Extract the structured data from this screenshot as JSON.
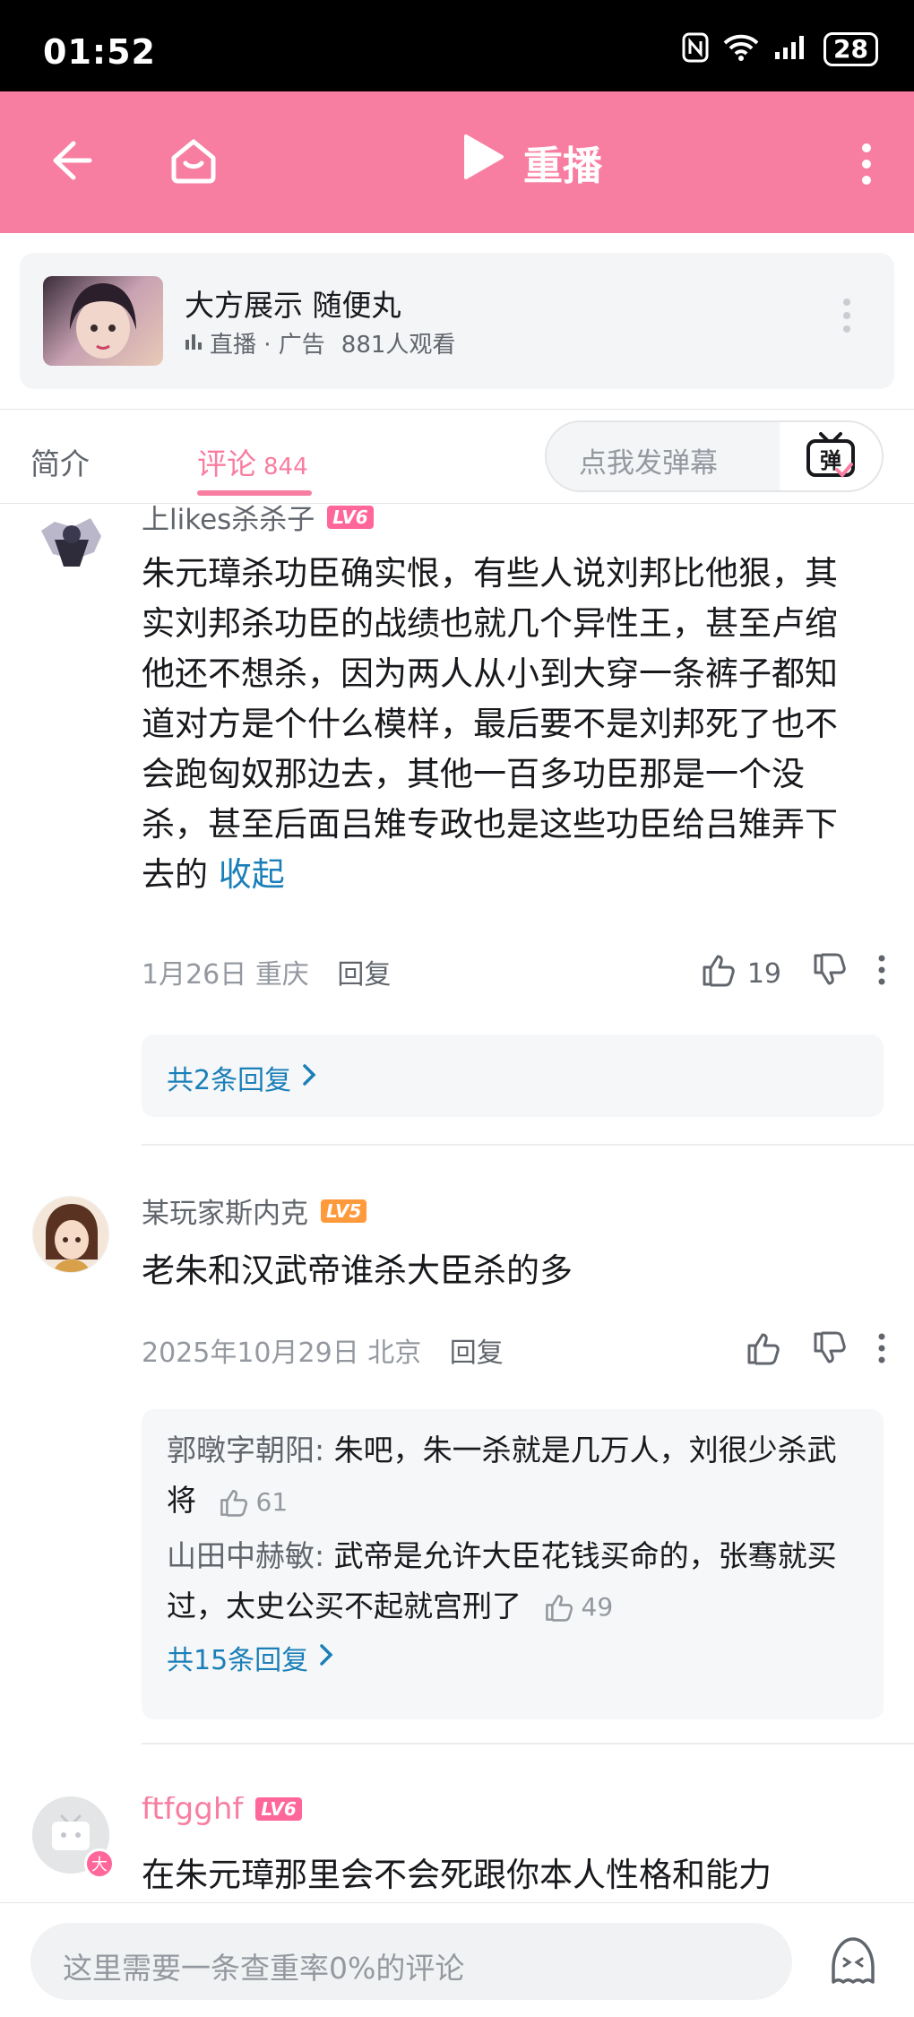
{
  "status": {
    "time": "01:52",
    "battery": "28"
  },
  "header": {
    "replay_label": "重播"
  },
  "live": {
    "title": "大方展示 随便丸",
    "tag": "直播 · 广告",
    "viewers": "881人观看"
  },
  "tabs": {
    "intro": "简介",
    "comments": "评论",
    "comment_count": "844"
  },
  "danmaku": {
    "placeholder": "点我发弹幕",
    "button": "弹"
  },
  "comments": [
    {
      "user": "上likes杀杀子",
      "level": "LV6",
      "text": "朱元璋杀功臣确实恨，有些人说刘邦比他狠，其实刘邦杀功臣的战绩也就几个异性王，甚至卢绾他还不想杀，因为两人从小到大穿一条裤子都知道对方是个什么模样，最后要不是刘邦死了也不会跑匈奴那边去，其他一百多功臣那是一个没杀，甚至后面吕雉专政也是这些功臣给吕雉弄下去的",
      "fold": "收起",
      "date": "1月26日",
      "location": "重庆",
      "reply": "回复",
      "likes": "19",
      "more_replies": "共2条回复"
    },
    {
      "user": "某玩家斯内克",
      "level": "LV5",
      "text": "老朱和汉武帝谁杀大臣杀的多",
      "date": "2025年10月29日",
      "location": "北京",
      "reply": "回复",
      "likes": "",
      "sub_replies": [
        {
          "user": "郭暾字朝阳:",
          "text": " 朱吧，朱一杀就是几万人，刘很少杀武将",
          "likes": "61"
        },
        {
          "user": "山田中赫敏:",
          "text": " 武帝是允许大臣花钱买命的，张骞就买过，太史公买不起就宫刑了",
          "likes": "49"
        }
      ],
      "more_replies": "共15条回复"
    },
    {
      "user": "ftfgghf",
      "level": "LV6",
      "badge": "大",
      "text": "在朱元璋那里会不会死跟你本人性格和能力"
    }
  ],
  "bottom": {
    "input_placeholder": "这里需要一条查重率0%的评论"
  },
  "colors": {
    "brand_pink": "#f87ea1",
    "link_blue": "#1a7fb8"
  }
}
